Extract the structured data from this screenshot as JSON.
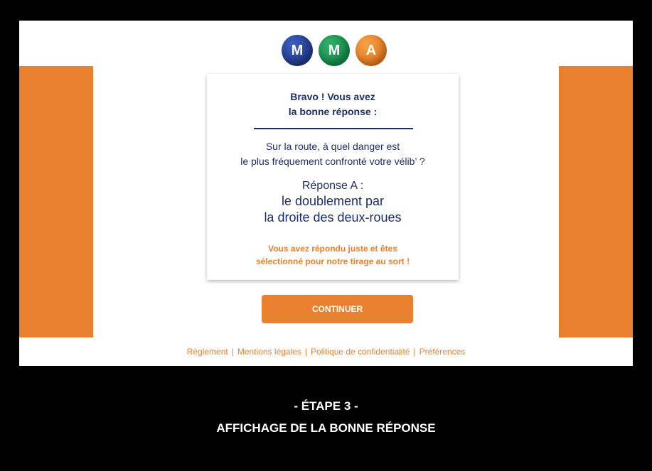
{
  "logo": {
    "letters": [
      "M",
      "M",
      "A"
    ]
  },
  "card": {
    "bravo_line1": "Bravo ! Vous avez",
    "bravo_line2": "la bonne réponse :",
    "question_line1": "Sur la route, à quel danger est",
    "question_line2": "le plus fréquement confronté votre vélib’ ?",
    "answer_head": "Réponse A :",
    "answer_line1": "le doublement par",
    "answer_line2": "la droite des deux-roues",
    "selected_line1": "Vous avez répondu juste et êtes",
    "selected_line2": "sélectionné pour notre tirage au sort !"
  },
  "continue_label": "CONTINUER",
  "footer": {
    "links": [
      "Règlement",
      "Mentions légales",
      "Politique de confidentialité",
      "Préférences"
    ],
    "separator": "|"
  },
  "caption": {
    "step": "- ÉTAPE 3 -",
    "title": "AFFICHAGE DE LA BONNE RÉPONSE"
  },
  "colors": {
    "accent_orange": "#e9802f",
    "navy": "#1c2d6b",
    "logo_blue": "#1f3a8a",
    "logo_green": "#138a47",
    "logo_orange": "#e57a1e"
  }
}
